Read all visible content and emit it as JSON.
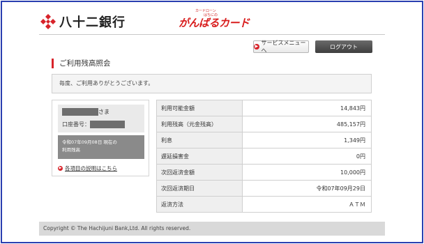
{
  "header": {
    "bank_name": "八十二銀行",
    "card_top_text": "カードローン",
    "card_sub_text": "はちにの",
    "card_name": "がんばるカード"
  },
  "actions": {
    "service_menu_label": "サービスメニューへ",
    "logout_label": "ログアウト"
  },
  "page": {
    "title": "ご利用残高照会",
    "greeting": "毎度、ご利用ありがとうございます。"
  },
  "account": {
    "name_suffix": "さま",
    "account_number_label": "口座番号：",
    "balance_date": "令和07年09月08日 現在の",
    "balance_caption": "利用残高",
    "help_link": "各項目の説明はこちら"
  },
  "balances": [
    {
      "label": "利用可能金額",
      "value": "14,843円"
    },
    {
      "label": "利用残高（元金残高）",
      "value": "485,157円"
    },
    {
      "label": "利息",
      "value": "1,349円"
    },
    {
      "label": "遅延損害金",
      "value": "0円"
    },
    {
      "label": "次回返済金額",
      "value": "10,000円"
    },
    {
      "label": "次回返済期日",
      "value": "令和07年09月29日"
    },
    {
      "label": "返済方法",
      "value": "ＡＴＭ"
    }
  ],
  "footer": {
    "copyright": "Copyright © The Hachijuni Bank,Ltd. All rights reserved."
  },
  "colors": {
    "frame_border": "#2a3fb0",
    "accent_red": "#d8232a",
    "logout_bg": "#4a4a4a"
  }
}
